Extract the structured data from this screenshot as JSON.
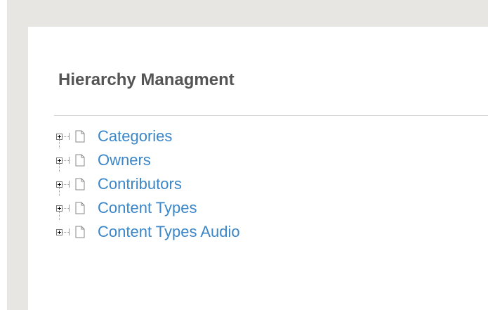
{
  "page": {
    "title": "Hierarchy Managment"
  },
  "tree": {
    "nodes": [
      {
        "label": "Categories",
        "icon": "file-icon",
        "expander": "plus-icon"
      },
      {
        "label": "Owners",
        "icon": "file-icon",
        "expander": "plus-icon"
      },
      {
        "label": "Contributors",
        "icon": "file-icon",
        "expander": "plus-icon"
      },
      {
        "label": "Content Types",
        "icon": "file-icon",
        "expander": "plus-icon"
      },
      {
        "label": "Content Types Audio",
        "icon": "file-icon",
        "expander": "plus-icon"
      }
    ]
  },
  "colors": {
    "background_frame": "#e7e6e2",
    "content_bg": "#ffffff",
    "title": "#555555",
    "link": "#3b86c8",
    "divider": "#cfcfcf"
  }
}
